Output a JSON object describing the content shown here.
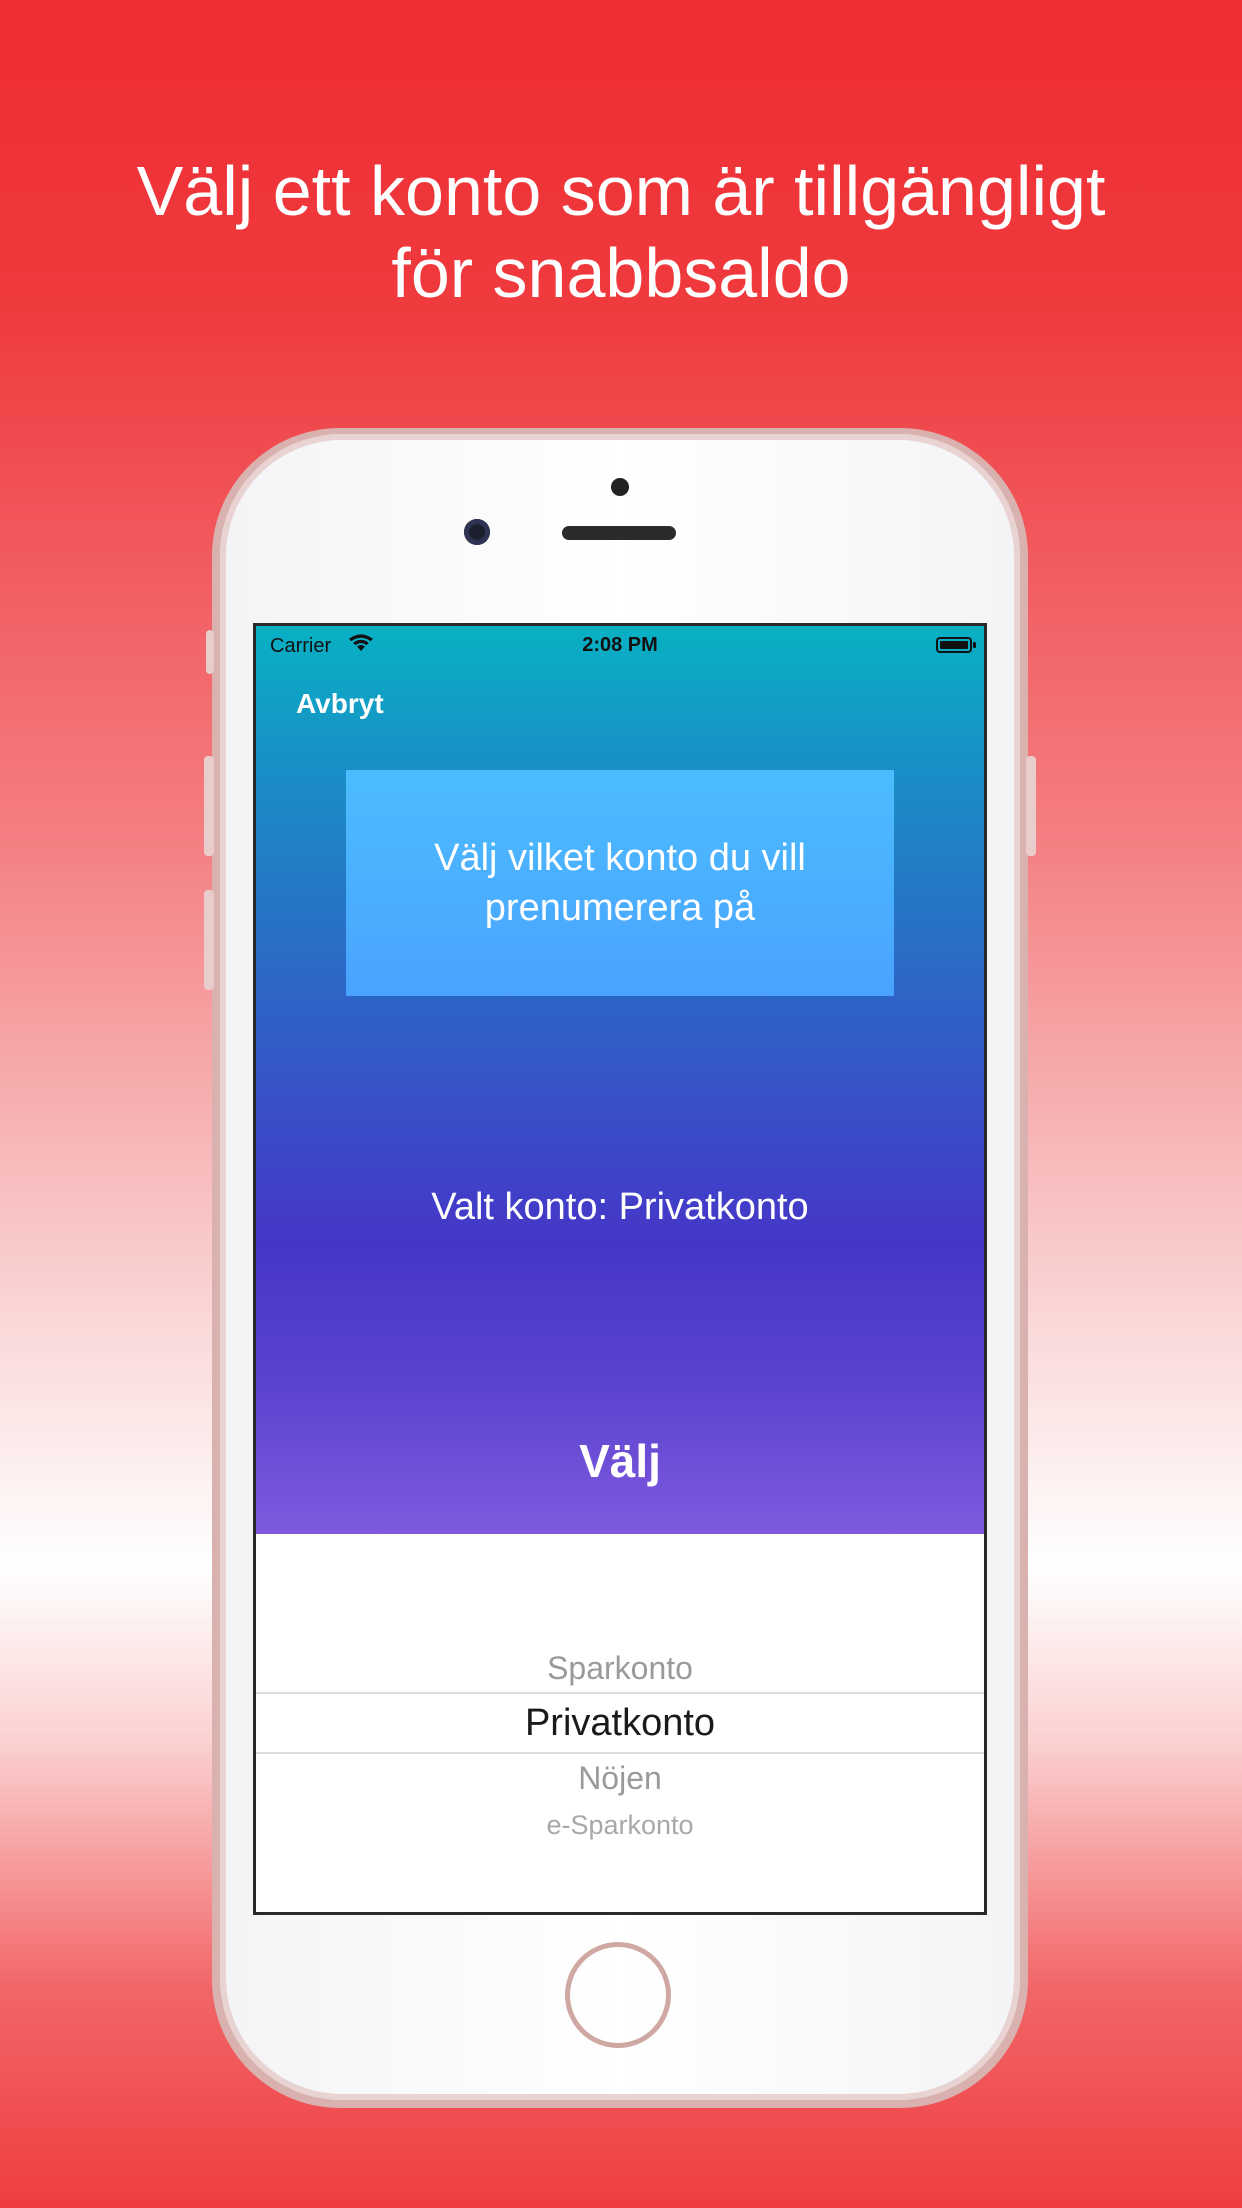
{
  "headline": {
    "line1": "Välj ett konto som är tillgängligt",
    "line2": "för snabbsaldo"
  },
  "status_bar": {
    "carrier": "Carrier",
    "time": "2:08 PM"
  },
  "nav": {
    "cancel_label": "Avbryt"
  },
  "info_box": {
    "text": "Välj vilket konto du vill prenumerera på"
  },
  "selected": {
    "text": "Valt konto: Privatkonto"
  },
  "action": {
    "choose_label": "Välj"
  },
  "picker": {
    "options": [
      "Sparkonto",
      "Privatkonto",
      "Nöjen",
      "e-Sparkonto"
    ],
    "selected_index": 1
  },
  "colors": {
    "background_red": "#ee2d33",
    "app_gradient_top": "#08b1c4",
    "app_gradient_bottom": "#7f5ade",
    "info_box": "#4cbcff"
  },
  "icons": [
    "wifi-icon",
    "battery-icon",
    "camera-icon",
    "home-button-icon"
  ]
}
